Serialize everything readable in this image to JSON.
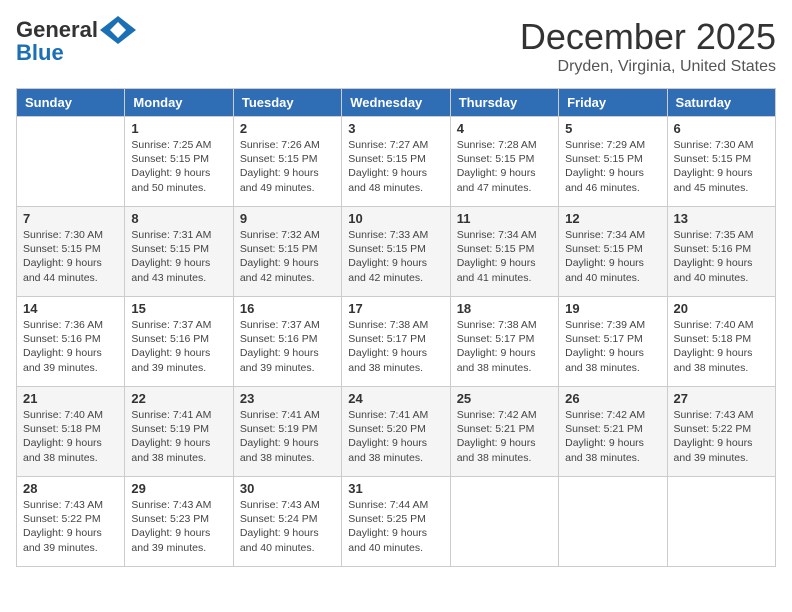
{
  "logo": {
    "line1": "General",
    "line2": "Blue"
  },
  "header": {
    "month": "December 2025",
    "location": "Dryden, Virginia, United States"
  },
  "weekdays": [
    "Sunday",
    "Monday",
    "Tuesday",
    "Wednesday",
    "Thursday",
    "Friday",
    "Saturday"
  ],
  "weeks": [
    [
      {
        "day": "",
        "info": ""
      },
      {
        "day": "1",
        "info": "Sunrise: 7:25 AM\nSunset: 5:15 PM\nDaylight: 9 hours\nand 50 minutes."
      },
      {
        "day": "2",
        "info": "Sunrise: 7:26 AM\nSunset: 5:15 PM\nDaylight: 9 hours\nand 49 minutes."
      },
      {
        "day": "3",
        "info": "Sunrise: 7:27 AM\nSunset: 5:15 PM\nDaylight: 9 hours\nand 48 minutes."
      },
      {
        "day": "4",
        "info": "Sunrise: 7:28 AM\nSunset: 5:15 PM\nDaylight: 9 hours\nand 47 minutes."
      },
      {
        "day": "5",
        "info": "Sunrise: 7:29 AM\nSunset: 5:15 PM\nDaylight: 9 hours\nand 46 minutes."
      },
      {
        "day": "6",
        "info": "Sunrise: 7:30 AM\nSunset: 5:15 PM\nDaylight: 9 hours\nand 45 minutes."
      }
    ],
    [
      {
        "day": "7",
        "info": "Sunrise: 7:30 AM\nSunset: 5:15 PM\nDaylight: 9 hours\nand 44 minutes."
      },
      {
        "day": "8",
        "info": "Sunrise: 7:31 AM\nSunset: 5:15 PM\nDaylight: 9 hours\nand 43 minutes."
      },
      {
        "day": "9",
        "info": "Sunrise: 7:32 AM\nSunset: 5:15 PM\nDaylight: 9 hours\nand 42 minutes."
      },
      {
        "day": "10",
        "info": "Sunrise: 7:33 AM\nSunset: 5:15 PM\nDaylight: 9 hours\nand 42 minutes."
      },
      {
        "day": "11",
        "info": "Sunrise: 7:34 AM\nSunset: 5:15 PM\nDaylight: 9 hours\nand 41 minutes."
      },
      {
        "day": "12",
        "info": "Sunrise: 7:34 AM\nSunset: 5:15 PM\nDaylight: 9 hours\nand 40 minutes."
      },
      {
        "day": "13",
        "info": "Sunrise: 7:35 AM\nSunset: 5:16 PM\nDaylight: 9 hours\nand 40 minutes."
      }
    ],
    [
      {
        "day": "14",
        "info": "Sunrise: 7:36 AM\nSunset: 5:16 PM\nDaylight: 9 hours\nand 39 minutes."
      },
      {
        "day": "15",
        "info": "Sunrise: 7:37 AM\nSunset: 5:16 PM\nDaylight: 9 hours\nand 39 minutes."
      },
      {
        "day": "16",
        "info": "Sunrise: 7:37 AM\nSunset: 5:16 PM\nDaylight: 9 hours\nand 39 minutes."
      },
      {
        "day": "17",
        "info": "Sunrise: 7:38 AM\nSunset: 5:17 PM\nDaylight: 9 hours\nand 38 minutes."
      },
      {
        "day": "18",
        "info": "Sunrise: 7:38 AM\nSunset: 5:17 PM\nDaylight: 9 hours\nand 38 minutes."
      },
      {
        "day": "19",
        "info": "Sunrise: 7:39 AM\nSunset: 5:17 PM\nDaylight: 9 hours\nand 38 minutes."
      },
      {
        "day": "20",
        "info": "Sunrise: 7:40 AM\nSunset: 5:18 PM\nDaylight: 9 hours\nand 38 minutes."
      }
    ],
    [
      {
        "day": "21",
        "info": "Sunrise: 7:40 AM\nSunset: 5:18 PM\nDaylight: 9 hours\nand 38 minutes."
      },
      {
        "day": "22",
        "info": "Sunrise: 7:41 AM\nSunset: 5:19 PM\nDaylight: 9 hours\nand 38 minutes."
      },
      {
        "day": "23",
        "info": "Sunrise: 7:41 AM\nSunset: 5:19 PM\nDaylight: 9 hours\nand 38 minutes."
      },
      {
        "day": "24",
        "info": "Sunrise: 7:41 AM\nSunset: 5:20 PM\nDaylight: 9 hours\nand 38 minutes."
      },
      {
        "day": "25",
        "info": "Sunrise: 7:42 AM\nSunset: 5:21 PM\nDaylight: 9 hours\nand 38 minutes."
      },
      {
        "day": "26",
        "info": "Sunrise: 7:42 AM\nSunset: 5:21 PM\nDaylight: 9 hours\nand 38 minutes."
      },
      {
        "day": "27",
        "info": "Sunrise: 7:43 AM\nSunset: 5:22 PM\nDaylight: 9 hours\nand 39 minutes."
      }
    ],
    [
      {
        "day": "28",
        "info": "Sunrise: 7:43 AM\nSunset: 5:22 PM\nDaylight: 9 hours\nand 39 minutes."
      },
      {
        "day": "29",
        "info": "Sunrise: 7:43 AM\nSunset: 5:23 PM\nDaylight: 9 hours\nand 39 minutes."
      },
      {
        "day": "30",
        "info": "Sunrise: 7:43 AM\nSunset: 5:24 PM\nDaylight: 9 hours\nand 40 minutes."
      },
      {
        "day": "31",
        "info": "Sunrise: 7:44 AM\nSunset: 5:25 PM\nDaylight: 9 hours\nand 40 minutes."
      },
      {
        "day": "",
        "info": ""
      },
      {
        "day": "",
        "info": ""
      },
      {
        "day": "",
        "info": ""
      }
    ]
  ]
}
